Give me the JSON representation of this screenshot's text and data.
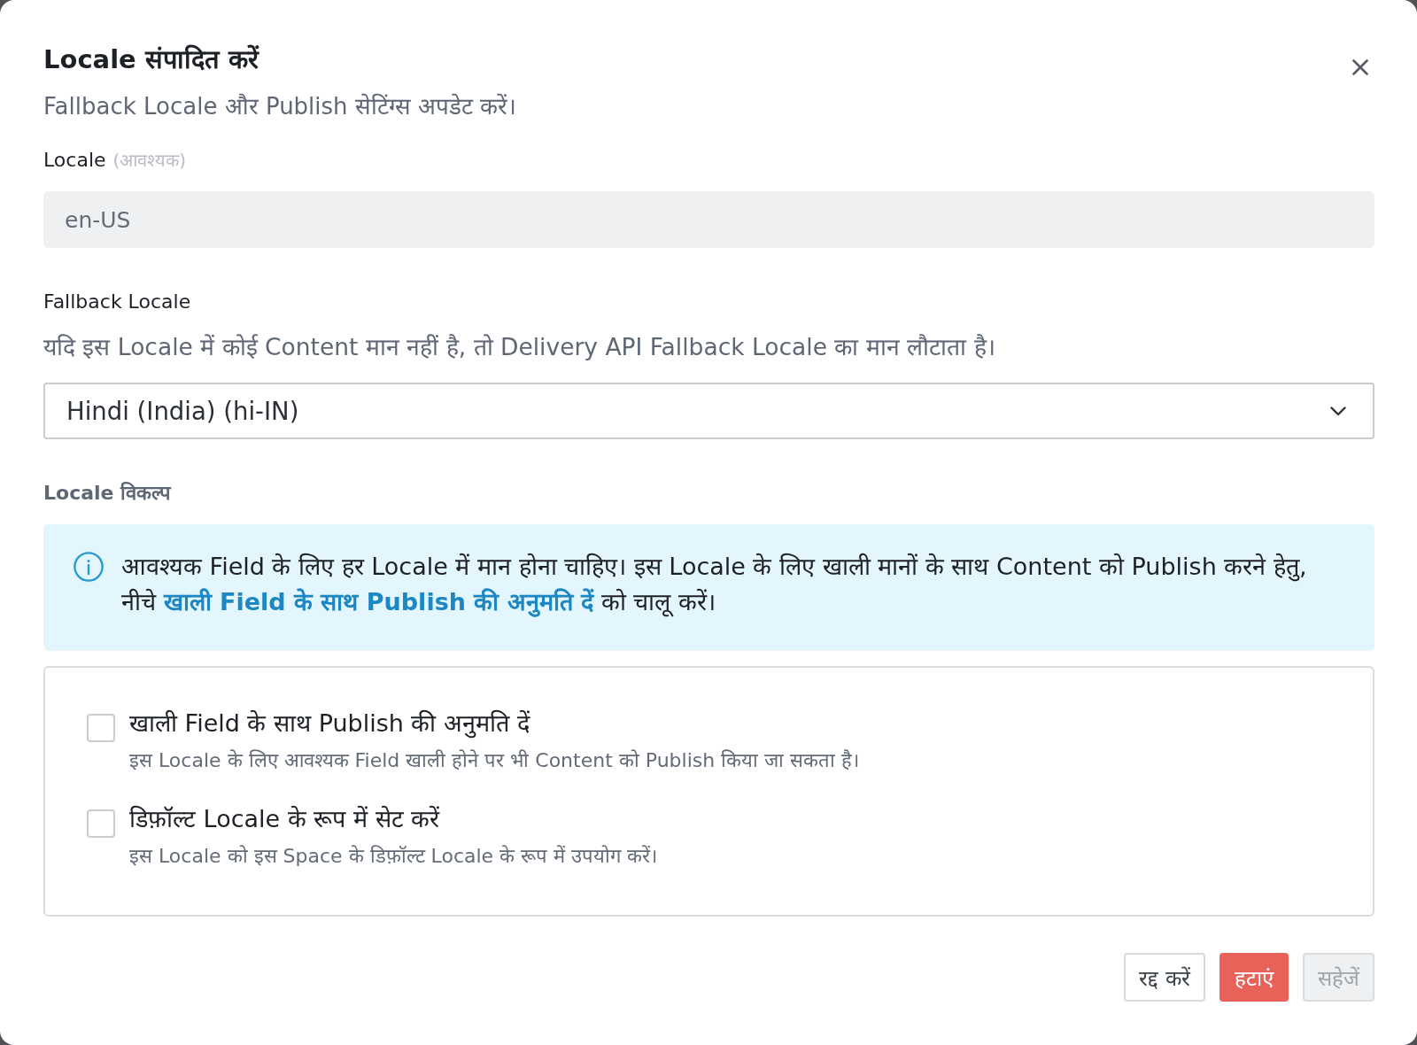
{
  "dialog": {
    "title": "Locale संपादित करें",
    "subtitle": "Fallback Locale और Publish सेटिंग्स अपडेट करें।"
  },
  "locale_field": {
    "label": "Locale",
    "hint": "(आवश्यक)",
    "value": "en-US",
    "disabled": true
  },
  "fallback_field": {
    "label": "Fallback Locale",
    "help": "यदि इस Locale में कोई Content मान नहीं है, तो Delivery API Fallback Locale का मान लौटाता है।",
    "value": "Hindi (India) (hi-IN)"
  },
  "options": {
    "heading": "Locale विकल्प",
    "notice": {
      "text_before": "आवश्यक Field के लिए हर Locale में मान होना चाहिए। इस Locale के लिए खाली मानों के साथ Content को Publish करने हेतु, नीचे ",
      "link": "खाली Field के साथ Publish की अनुमति दें",
      "text_after": " को चालू करें।"
    },
    "checkboxes": [
      {
        "label": "खाली Field के साथ Publish की अनुमति दें",
        "description": "इस Locale के लिए आवश्यक Field खाली होने पर भी Content को Publish किया जा सकता है।",
        "checked": false
      },
      {
        "label": "डिफ़ॉल्ट Locale के रूप में सेट करें",
        "description": "इस Locale को इस Space के डिफ़ॉल्ट Locale के रूप में उपयोग करें।",
        "checked": false
      }
    ]
  },
  "buttons": [
    {
      "label": "रद्द करें",
      "kind": "secondary",
      "disabled": false
    },
    {
      "label": "हटाएं",
      "kind": "danger",
      "disabled": false
    },
    {
      "label": "सहेजें",
      "kind": "primary",
      "disabled": true
    }
  ]
}
